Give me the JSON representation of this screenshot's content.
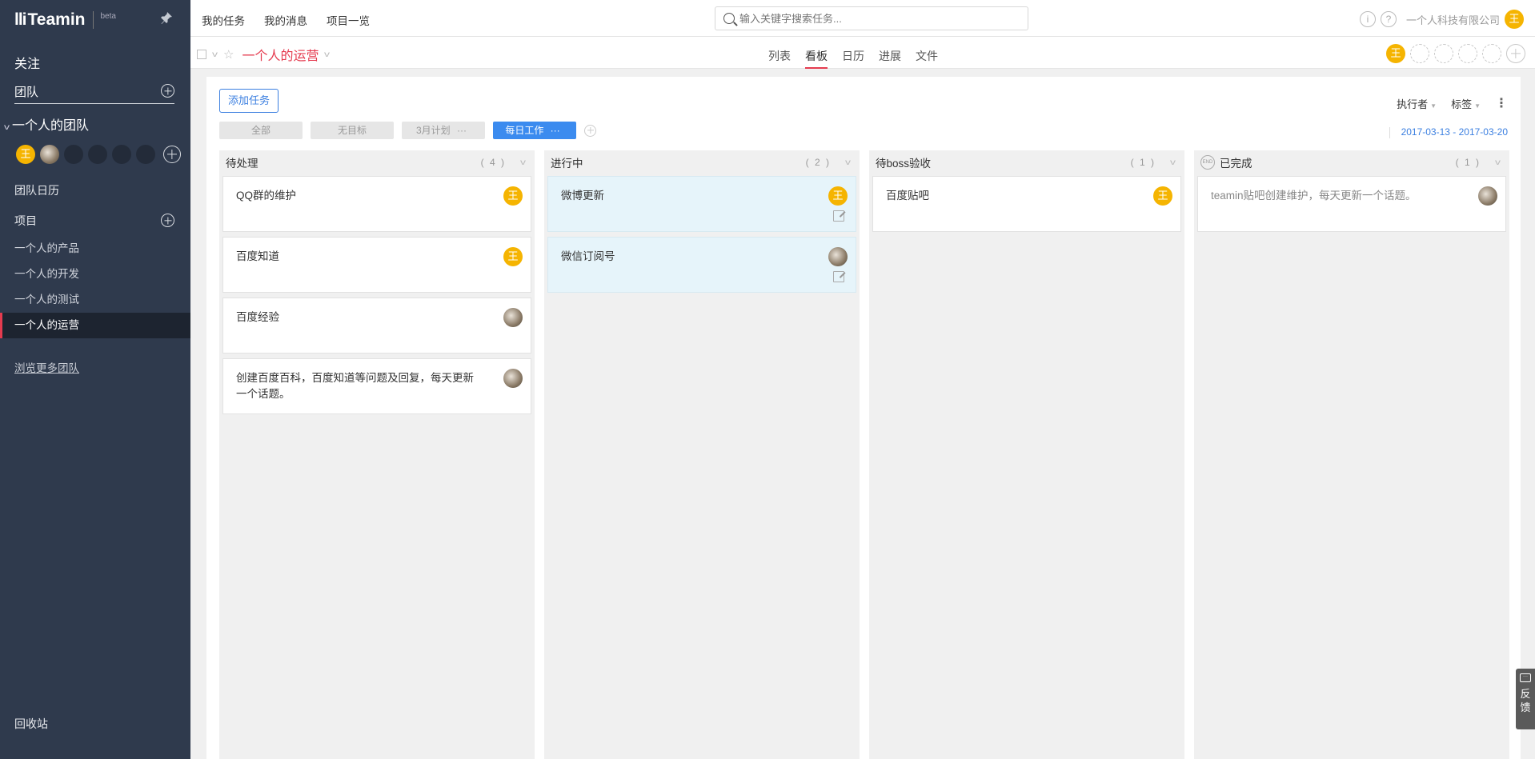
{
  "sidebar": {
    "logo_mark": "lli",
    "logo_text": "Teamin",
    "beta": "beta",
    "follow": "关注",
    "team": "团队",
    "my_team": "一个人的团队",
    "member_wang": "王",
    "team_calendar": "团队日历",
    "projects": "项目",
    "project_items": [
      {
        "label": "一个人的产品"
      },
      {
        "label": "一个人的开发"
      },
      {
        "label": "一个人的测试"
      },
      {
        "label": "一个人的运营"
      }
    ],
    "browse_more": "浏览更多团队",
    "trash": "回收站"
  },
  "topbar": {
    "nav": [
      {
        "label": "我的任务"
      },
      {
        "label": "我的消息"
      },
      {
        "label": "项目一览"
      }
    ],
    "search_placeholder": "输入关键字搜索任务...",
    "info_icon": "i",
    "help_icon": "?",
    "company": "一个人科技有限公司",
    "user_avatar": "王"
  },
  "project": {
    "title": "一个人的运营",
    "tabs": [
      {
        "label": "列表"
      },
      {
        "label": "看板"
      },
      {
        "label": "日历"
      },
      {
        "label": "进展"
      },
      {
        "label": "文件"
      }
    ],
    "active_tab": "看板",
    "member": "王"
  },
  "board": {
    "add_task": "添加任务",
    "filters": [
      {
        "label": "全部"
      },
      {
        "label": "无目标"
      },
      {
        "label": "3月计划"
      },
      {
        "label": "每日工作"
      }
    ],
    "filter_more": "···",
    "assignee": "执行者",
    "tags": "标签",
    "date_range": "2017-03-13 - 2017-03-20",
    "columns": [
      {
        "title": "待处理",
        "count": "( 4 )",
        "cards": [
          {
            "title": "QQ群的维护",
            "avatar": "王"
          },
          {
            "title": "百度知道",
            "avatar": "王"
          },
          {
            "title": "百度经验",
            "avatar": ""
          },
          {
            "title": "创建百度百科，百度知道等问题及回复，每天更新一个话题。",
            "avatar": ""
          }
        ]
      },
      {
        "title": "进行中",
        "count": "( 2 )",
        "cards": [
          {
            "title": "微博更新",
            "avatar": "王"
          },
          {
            "title": "微信订阅号",
            "avatar": ""
          }
        ]
      },
      {
        "title": "待boss验收",
        "count": "( 1 )",
        "cards": [
          {
            "title": "百度贴吧",
            "avatar": "王"
          }
        ]
      },
      {
        "title": "已完成",
        "end_badge": "END",
        "count": "( 1 )",
        "cards": [
          {
            "title": "teamin贴吧创建维护，每天更新一个话题。",
            "avatar": ""
          }
        ]
      }
    ]
  },
  "feedback": {
    "label_1": "反",
    "label_2": "馈"
  },
  "colors": {
    "sidebar_bg": "#2f3a4d",
    "accent_red": "#e53b4f",
    "accent_blue": "#3b8bef",
    "avatar_yellow": "#f5b401",
    "highlight_card": "#e6f4fa"
  }
}
